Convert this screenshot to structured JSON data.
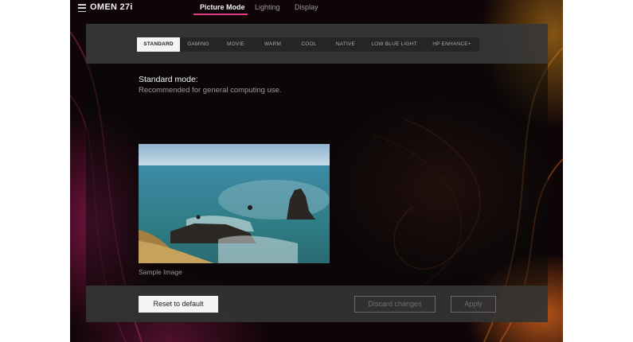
{
  "app": {
    "title": "OMEN 27i"
  },
  "nav": {
    "tabs": [
      {
        "label": "Picture Mode",
        "active": true
      },
      {
        "label": "Lighting",
        "active": false
      },
      {
        "label": "Display",
        "active": false
      }
    ]
  },
  "modes": {
    "items": [
      "STANDARD",
      "GAMING",
      "MOVIE",
      "WARM",
      "COOL",
      "NATIVE",
      "LOW BLUE LIGHT",
      "HP ENHANCE+"
    ],
    "selected": "STANDARD"
  },
  "description": {
    "title": "Standard mode:",
    "text": "Recommended for general computing use."
  },
  "sample": {
    "caption": "Sample Image"
  },
  "actions": {
    "reset_label": "Reset to default",
    "discard_label": "Discard changes",
    "apply_label": "Apply"
  },
  "colors": {
    "accent": "#e03c8a",
    "background": "#0f0507"
  },
  "icons": {
    "menu": "hamburger-menu-icon"
  }
}
